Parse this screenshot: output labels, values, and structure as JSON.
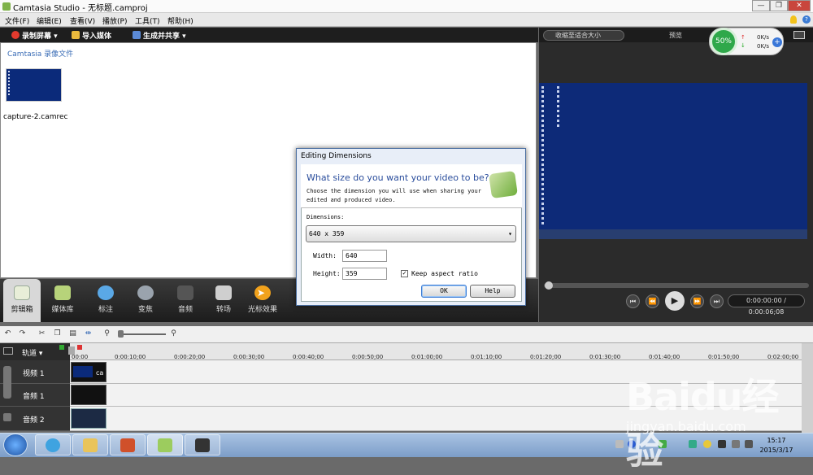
{
  "window": {
    "title": "Camtasia Studio - 无标题.camproj",
    "buttons": [
      "—",
      "❐",
      "✕"
    ]
  },
  "menu": [
    "文件(F)",
    "编辑(E)",
    "查看(V)",
    "播放(P)",
    "工具(T)",
    "帮助(H)"
  ],
  "toolbar": {
    "record": "录制屏幕 ▾",
    "import": "导入媒体",
    "produce": "生成并共享 ▾"
  },
  "clipbin": {
    "header": "Camtasia 录像文件",
    "clip_name": "capture-2.camrec"
  },
  "preview": {
    "size_select": "收缩至适合大小",
    "label": "预览",
    "time": "0:00:00:00 / 0:00:06;08"
  },
  "netwidget": {
    "percent": "50%",
    "up": "0K/s",
    "down": "0K/s"
  },
  "tasks": [
    {
      "label": "剪辑箱",
      "color": "#e8eed8"
    },
    {
      "label": "媒体库",
      "color": "#b7d37a"
    },
    {
      "label": "标注",
      "color": "#5aa8e6"
    },
    {
      "label": "变焦",
      "color": "#9aa3ad"
    },
    {
      "label": "音频",
      "color": "#555555"
    },
    {
      "label": "转场",
      "color": "#cfcfcf"
    },
    {
      "label": "光标效果",
      "color": "#f2a21c"
    }
  ],
  "timeline": {
    "track_menu": "轨道 ▾",
    "ticks": [
      "00:00",
      "0:00:10;00",
      "0:00:20;00",
      "0:00:30;00",
      "0:00:40;00",
      "0:00:50;00",
      "0:01:00;00",
      "0:01:10;00",
      "0:01:20;00",
      "0:01:30;00",
      "0:01:40;00",
      "0:01:50;00",
      "0:02:00;00"
    ],
    "tracks": [
      "视频 1",
      "音频 1",
      "音频 2"
    ],
    "clip_label": "ca"
  },
  "dialog": {
    "title": "Editing Dimensions",
    "question": "What size do you want your video to be?",
    "desc1": "Choose the dimension you will use when sharing your",
    "desc2": "edited and produced video.",
    "dim_label": "Dimensions:",
    "dim_value": "640 x 359",
    "width_label": "Width:",
    "width_value": "640",
    "height_label": "Height:",
    "height_value": "359",
    "keep_label": "Keep aspect ratio",
    "ok": "OK",
    "help": "Help"
  },
  "clock": {
    "time": "15:17",
    "date": "2015/3/17"
  },
  "watermark": {
    "brand": "Baidu经验",
    "url": "jingyan.baidu.com"
  }
}
